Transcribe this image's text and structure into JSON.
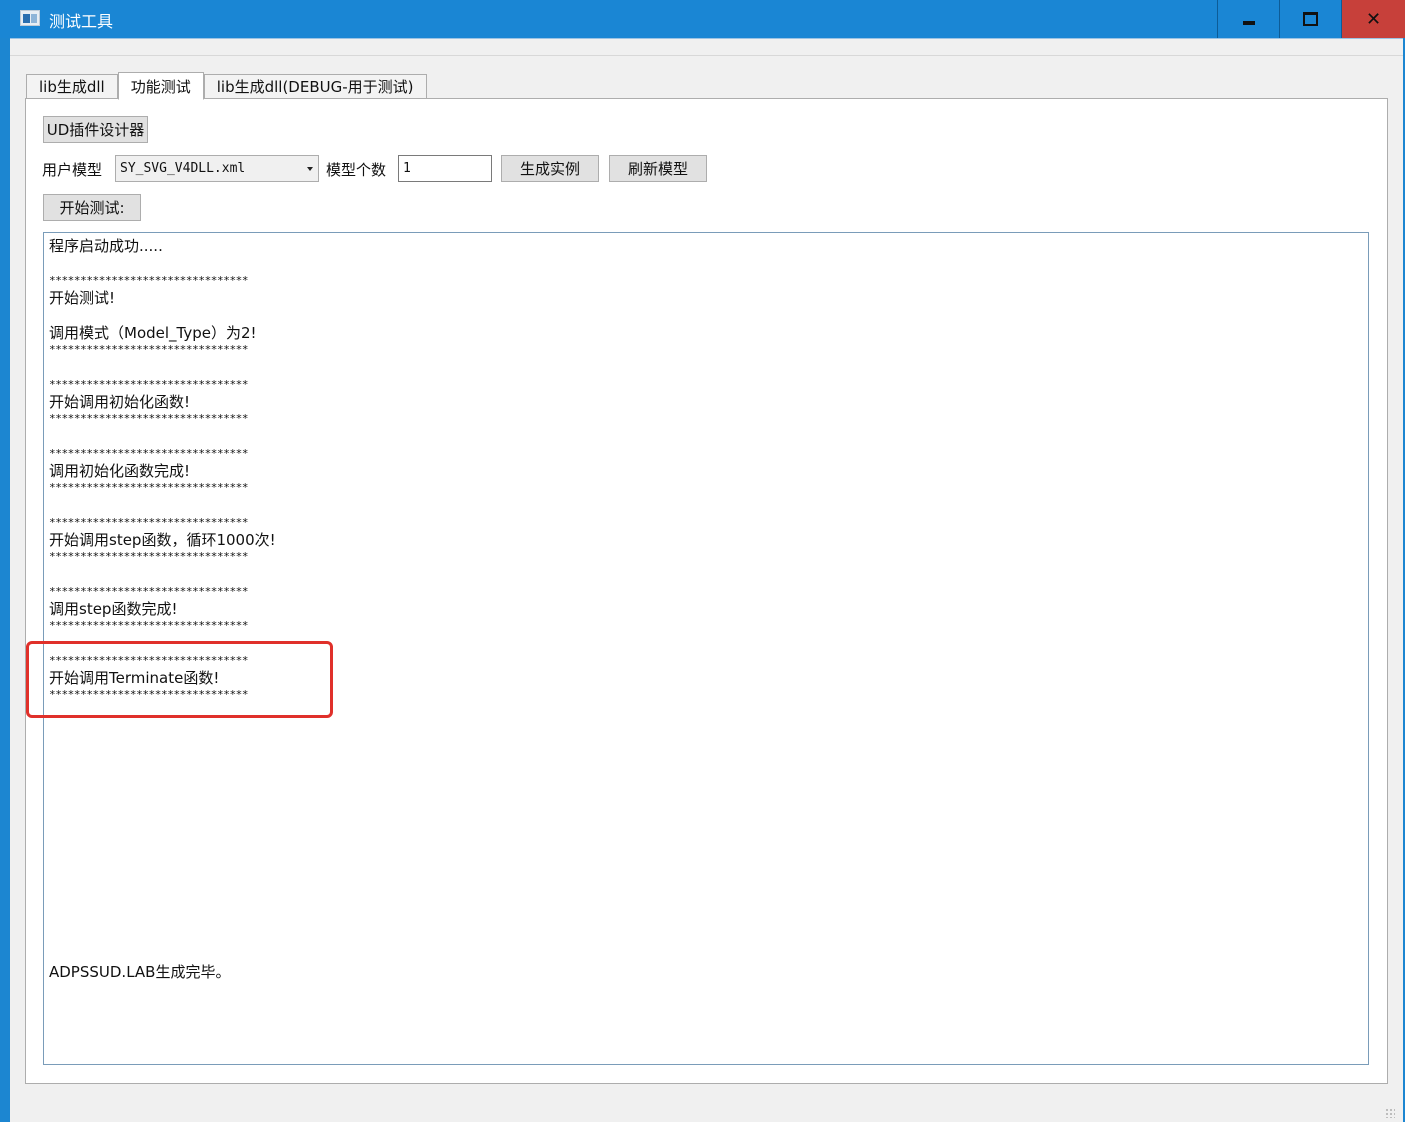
{
  "window": {
    "title": "测试工具",
    "controls": {
      "minimize": "minimize",
      "maximize": "maximize",
      "close": "close"
    }
  },
  "tabs": [
    {
      "label": "lib生成dll",
      "active": false
    },
    {
      "label": "功能测试",
      "active": true
    },
    {
      "label": "lib生成dll(DEBUG-用于测试)",
      "active": false
    }
  ],
  "panel": {
    "ui_designer_button": "UD插件设计器",
    "user_model_label": "用户模型",
    "user_model_value": "SY_SVG_V4DLL.xml",
    "model_count_label": "模型个数",
    "model_count_value": "1",
    "generate_instance_button": "生成实例",
    "refresh_model_button": "刷新模型",
    "start_test_button": "开始测试:"
  },
  "log": {
    "stars": "********************************",
    "lines": [
      "程序启动成功.....",
      "开始测试!",
      "调用模式（Model_Type）为2!",
      "开始调用初始化函数!",
      "调用初始化函数完成!",
      "开始调用step函数，循环1000次!",
      "调用step函数完成!",
      "开始调用Terminate函数!",
      "ADPSSUD.LAB生成完毕。"
    ]
  },
  "annotation": {
    "highlight_color": "#e0302a"
  }
}
